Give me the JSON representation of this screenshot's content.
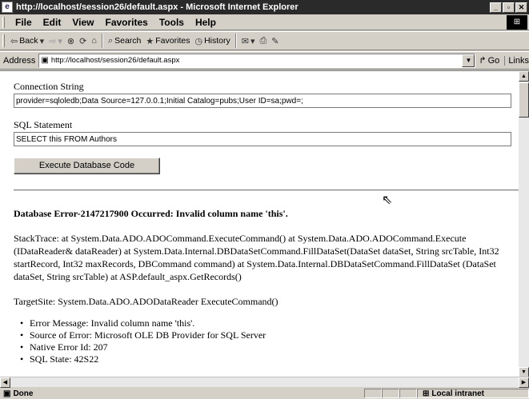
{
  "window": {
    "title": "http://localhost/session26/default.aspx - Microsoft Internet Explorer",
    "buttons": [
      "_",
      "▫",
      "✕"
    ]
  },
  "menu": [
    "File",
    "Edit",
    "View",
    "Favorites",
    "Tools",
    "Help"
  ],
  "toolbar": {
    "back": "Back",
    "search": "Search",
    "favorites": "Favorites",
    "history": "History"
  },
  "address": {
    "label": "Address",
    "url": "http://localhost/session26/default.aspx",
    "go": "Go",
    "links": "Links"
  },
  "form": {
    "connection_label": "Connection String",
    "connection_value": "provider=sqloledb;Data Source=127.0.0.1;Initial Catalog=pubs;User ID=sa;pwd=;",
    "sql_label": "SQL Statement",
    "sql_value": "SELECT this FROM Authors",
    "execute_button": "Execute Database Code"
  },
  "error": {
    "heading": "Database Error-2147217900 Occurred: Invalid column name 'this'.",
    "stacktrace": "StackTrace: at System.Data.ADO.ADOCommand.ExecuteCommand() at System.Data.ADO.ADOCommand.Execute (IDataReader& dataReader) at System.Data.Internal.DBDataSetCommand.FillDataSet(DataSet dataSet, String srcTable, Int32 startRecord, Int32 maxRecords, DBCommand command) at System.Data.Internal.DBDataSetCommand.FillDataSet (DataSet dataSet, String srcTable) at ASP.default_aspx.GetRecords()",
    "targetsite": "TargetSite: System.Data.ADO.ADODataReader ExecuteCommand()",
    "details": [
      "Error Message: Invalid column name 'this'.",
      "Source of Error: Microsoft OLE DB Provider for SQL Server",
      "Native Error Id: 207",
      "SQL State: 42S22"
    ]
  },
  "status": {
    "text": "Done",
    "zone": "Local intranet"
  }
}
